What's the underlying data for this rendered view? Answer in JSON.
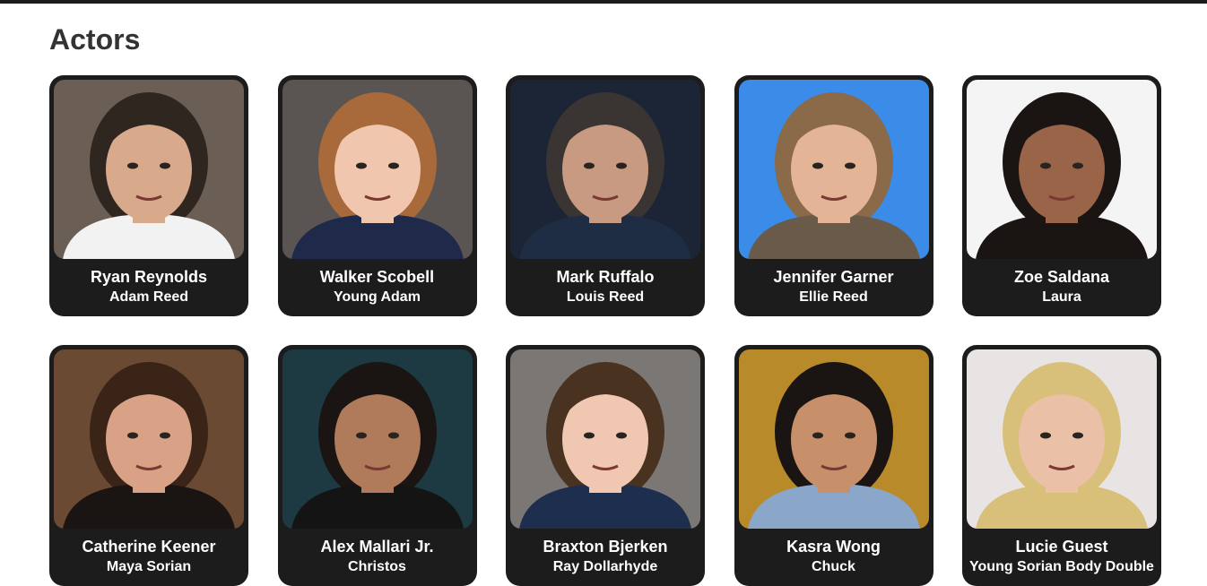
{
  "section": {
    "title": "Actors"
  },
  "actors": [
    {
      "name": "Ryan Reynolds",
      "role": "Adam Reed",
      "bg": "#6b5e55",
      "skin": "#d9a98c",
      "hair": "#2f2620",
      "shirt": "#f2f2f2"
    },
    {
      "name": "Walker Scobell",
      "role": "Young Adam",
      "bg": "#5a5552",
      "skin": "#f0c6ae",
      "hair": "#a86a3a",
      "shirt": "#1f2a4a"
    },
    {
      "name": "Mark Ruffalo",
      "role": "Louis Reed",
      "bg": "#1b2536",
      "skin": "#c99a82",
      "hair": "#3a3532",
      "shirt": "#1e2c44"
    },
    {
      "name": "Jennifer Garner",
      "role": "Ellie Reed",
      "bg": "#3b8be8",
      "skin": "#e4b497",
      "hair": "#8a6a48",
      "shirt": "#6a5a4a"
    },
    {
      "name": "Zoe Saldana",
      "role": "Laura",
      "bg": "#f4f4f4",
      "skin": "#9a6448",
      "hair": "#1a1412",
      "shirt": "#1a1412"
    },
    {
      "name": "Catherine Keener",
      "role": "Maya Sorian",
      "bg": "#6a4a32",
      "skin": "#d9a286",
      "hair": "#3a2418",
      "shirt": "#1a1412"
    },
    {
      "name": "Alex Mallari Jr.",
      "role": "Christos",
      "bg": "#1d3a42",
      "skin": "#b07b5a",
      "hair": "#1a1412",
      "shirt": "#141414"
    },
    {
      "name": "Braxton Bjerken",
      "role": "Ray Dollarhyde",
      "bg": "#7a7774",
      "skin": "#f0c8b2",
      "hair": "#4a3220",
      "shirt": "#1d2e4e"
    },
    {
      "name": "Kasra Wong",
      "role": "Chuck",
      "bg": "#b88a2a",
      "skin": "#c8906a",
      "hair": "#1a1412",
      "shirt": "#8aa6c8"
    },
    {
      "name": "Lucie Guest",
      "role": "Young Sorian Body Double",
      "bg": "#e8e4e4",
      "skin": "#eac0a6",
      "hair": "#d9c07a",
      "shirt": "#d9c07a"
    }
  ]
}
